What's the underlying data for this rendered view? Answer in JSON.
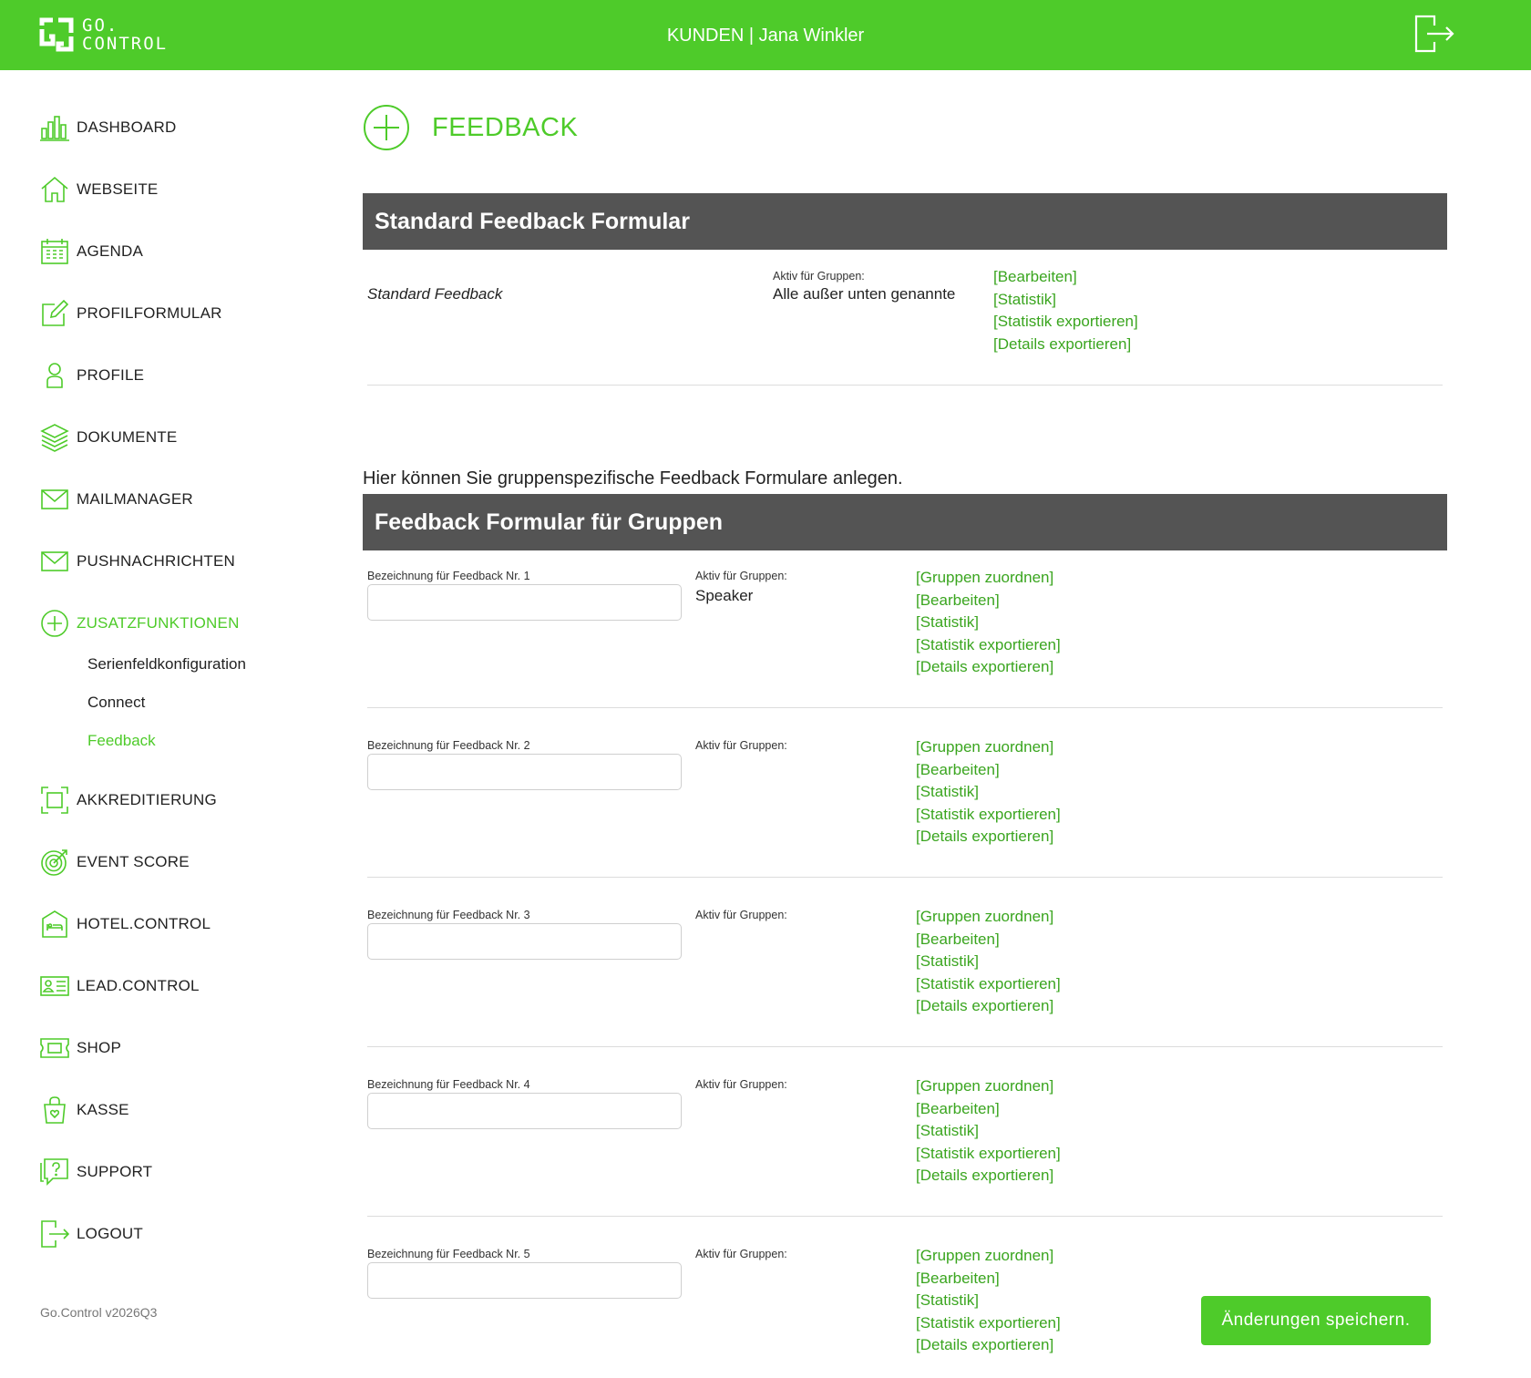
{
  "header": {
    "logo_line1": "GO.",
    "logo_line2": "CONTROL",
    "title": "KUNDEN | Jana Winkler",
    "logout_icon": "logout-icon",
    "color": "#4ecb2a"
  },
  "sidebar": {
    "items": [
      {
        "label": "DASHBOARD",
        "icon": "bar-chart-icon"
      },
      {
        "label": "WEBSEITE",
        "icon": "home-icon"
      },
      {
        "label": "AGENDA",
        "icon": "calendar-icon"
      },
      {
        "label": "PROFILFORMULAR",
        "icon": "edit-icon"
      },
      {
        "label": "PROFILE",
        "icon": "user-icon"
      },
      {
        "label": "DOKUMENTE",
        "icon": "layers-icon"
      },
      {
        "label": "MAILMANAGER",
        "icon": "mail-icon"
      },
      {
        "label": "PUSHNACHRICHTEN",
        "icon": "mail-icon"
      },
      {
        "label": "ZUSATZFUNKTIONEN",
        "icon": "plus-circle-icon"
      },
      {
        "label": "AKKREDITIERUNG",
        "icon": "scan-frame-icon"
      },
      {
        "label": "EVENT SCORE",
        "icon": "target-icon"
      },
      {
        "label": "HOTEL.CONTROL",
        "icon": "hotel-icon"
      },
      {
        "label": "LEAD.CONTROL",
        "icon": "id-card-icon"
      },
      {
        "label": "SHOP",
        "icon": "ticket-icon"
      },
      {
        "label": "KASSE",
        "icon": "shopping-bag-icon"
      },
      {
        "label": "SUPPORT",
        "icon": "help-chat-icon"
      },
      {
        "label": "LOGOUT",
        "icon": "logout-icon"
      }
    ],
    "subitems": [
      {
        "label": "Serienfeldkonfiguration"
      },
      {
        "label": "Connect"
      },
      {
        "label": "Feedback"
      }
    ],
    "version": "Go.Control v2026Q3"
  },
  "main": {
    "page_title": "FEEDBACK",
    "standard": {
      "section_title": "Standard Feedback Formular",
      "name": "Standard Feedback",
      "groups_label": "Aktiv für Gruppen:",
      "groups_value": "Alle außer unten genannte",
      "links": [
        "[Bearbeiten]",
        "[Statistik]",
        "[Statistik exportieren]",
        "[Details exportieren]"
      ]
    },
    "intro": "Hier können Sie gruppenspezifische Feedback Formulare anlegen.",
    "groups_section_title": "Feedback Formular für Gruppen",
    "group_forms": [
      {
        "name_label": "Bezeichnung für Feedback Nr. 1",
        "name_value": "",
        "groups_label": "Aktiv für Gruppen:",
        "groups_value": "Speaker"
      },
      {
        "name_label": "Bezeichnung für Feedback Nr. 2",
        "name_value": "",
        "groups_label": "Aktiv für Gruppen:",
        "groups_value": ""
      },
      {
        "name_label": "Bezeichnung für Feedback Nr. 3",
        "name_value": "",
        "groups_label": "Aktiv für Gruppen:",
        "groups_value": ""
      },
      {
        "name_label": "Bezeichnung für Feedback Nr. 4",
        "name_value": "",
        "groups_label": "Aktiv für Gruppen:",
        "groups_value": ""
      },
      {
        "name_label": "Bezeichnung für Feedback Nr. 5",
        "name_value": "",
        "groups_label": "Aktiv für Gruppen:",
        "groups_value": ""
      }
    ],
    "group_links": [
      "[Gruppen zuordnen]",
      "[Bearbeiten]",
      "[Statistik]",
      "[Statistik exportieren]",
      "[Details exportieren]"
    ],
    "save_label": "Änderungen speichern."
  }
}
